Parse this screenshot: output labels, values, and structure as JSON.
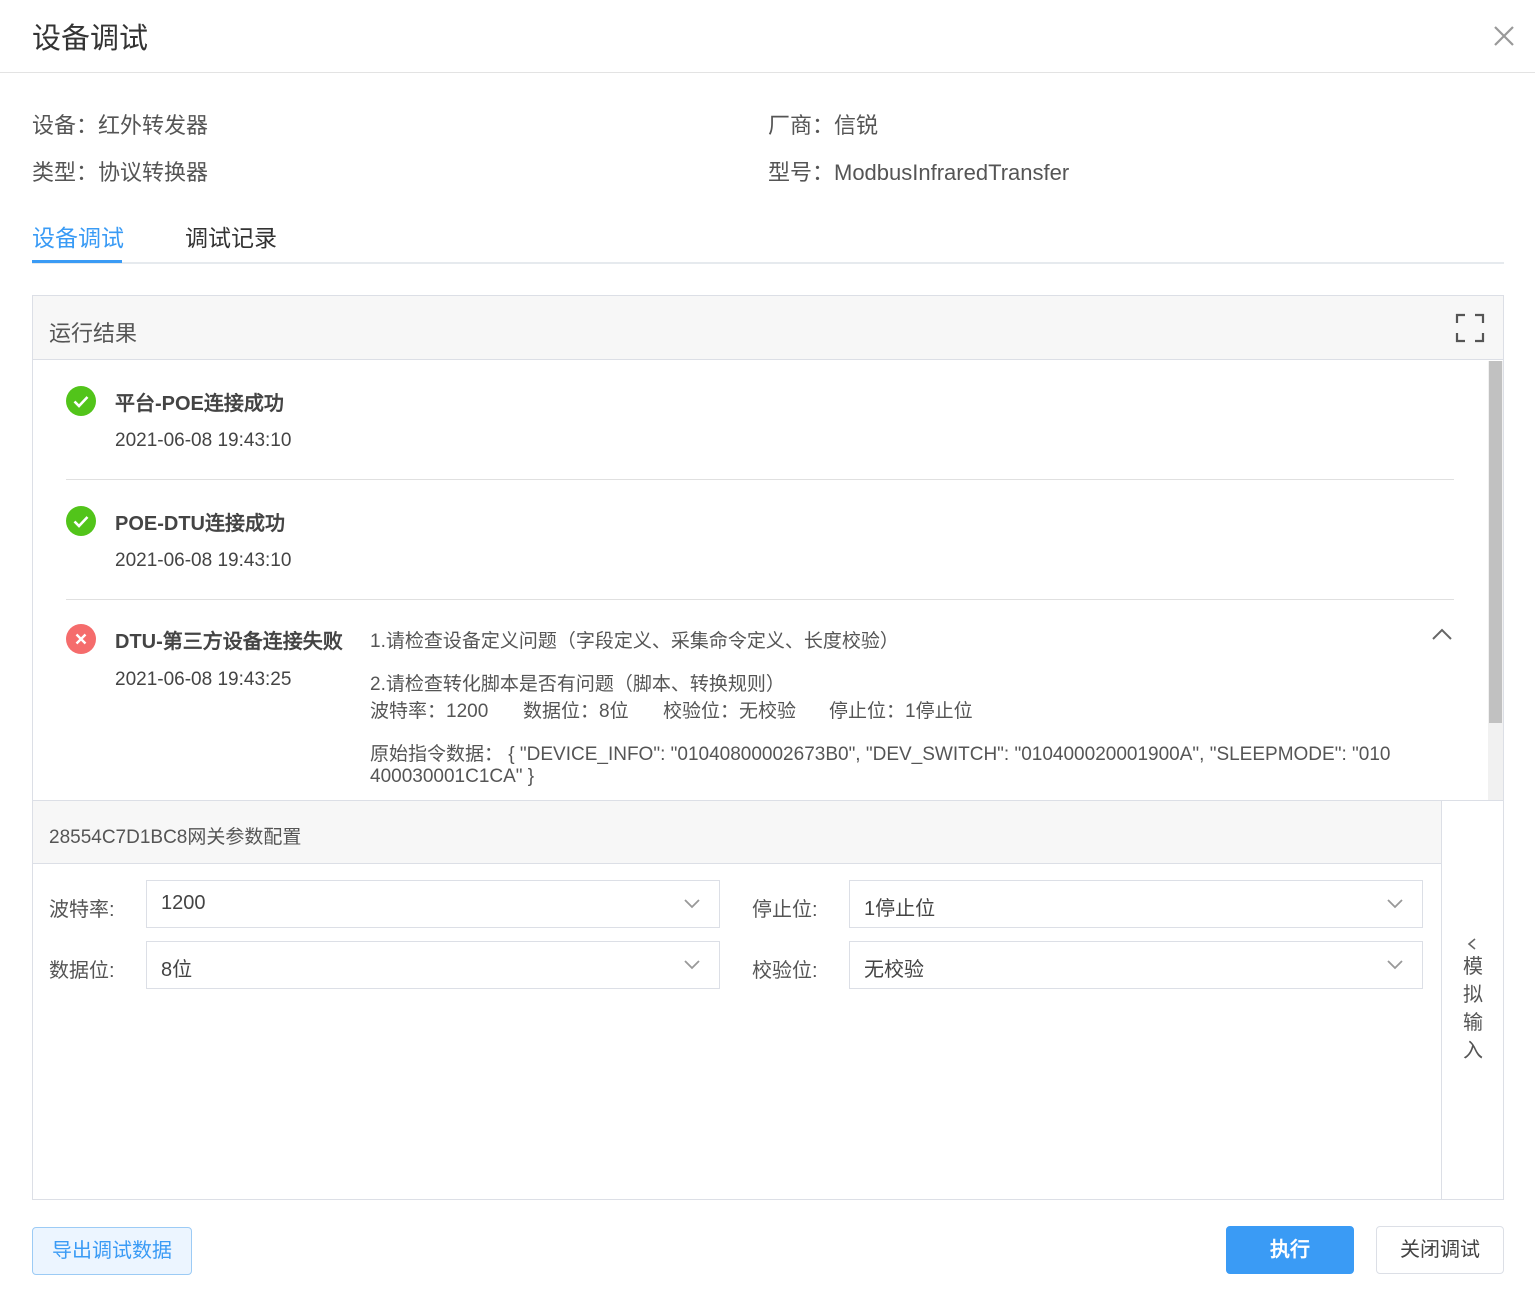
{
  "dialog": {
    "title": "设备调试"
  },
  "info": {
    "device": "设备：红外转发器",
    "vendor": "厂商：信锐",
    "type": "类型：协议转换器",
    "model": "型号：ModbusInfraredTransfer"
  },
  "tabs": [
    {
      "label": "设备调试",
      "active": true
    },
    {
      "label": "调试记录",
      "active": false
    }
  ],
  "result": {
    "title": "运行结果",
    "items": [
      {
        "status": "success",
        "name": "平台-POE连接成功",
        "time": "2021-06-08 19:43:10"
      },
      {
        "status": "success",
        "name": "POE-DTU连接成功",
        "time": "2021-06-08 19:43:10"
      },
      {
        "status": "error",
        "name": "DTU-第三方设备连接失败",
        "time": "2021-06-08 19:43:25",
        "details": {
          "line1": "1.请检查设备定义问题（字段定义、采集命令定义、长度校验）",
          "line2": "2.请检查转化脚本是否有问题（脚本、转换规则）",
          "baud": "波特率：1200",
          "databits": "数据位：8位",
          "parity": "校验位：无校验",
          "stopbits": "停止位：1停止位",
          "raw_line1": "原始指令数据： { \"DEVICE_INFO\": \"01040800002673B0\", \"DEV_SWITCH\": \"010400020001900A\", \"SLEEPMODE\": \"010",
          "raw_line2": "400030001C1CA\" }"
        }
      }
    ]
  },
  "config": {
    "title": "28554C7D1BC8网关参数配置",
    "side_tab": "模拟输入",
    "fields": {
      "baud": {
        "label": "波特率:",
        "value": "1200"
      },
      "stop": {
        "label": "停止位:",
        "value": "1停止位"
      },
      "data": {
        "label": "数据位:",
        "value": "8位"
      },
      "parity": {
        "label": "校验位:",
        "value": "无校验"
      }
    }
  },
  "buttons": {
    "export": "导出调试数据",
    "execute": "执行",
    "close": "关闭调试"
  },
  "colors": {
    "accent": "#3a9bf5",
    "success": "#52c41a",
    "error": "#f56c6c"
  },
  "icons": {
    "close": "close-icon",
    "expand": "fullscreen-icon",
    "collapse": "chevron-up-icon",
    "select_arrow": "chevron-down-icon",
    "side_tab": "chevron-left-icon",
    "success": "check-circle-icon",
    "error": "x-circle-icon"
  }
}
